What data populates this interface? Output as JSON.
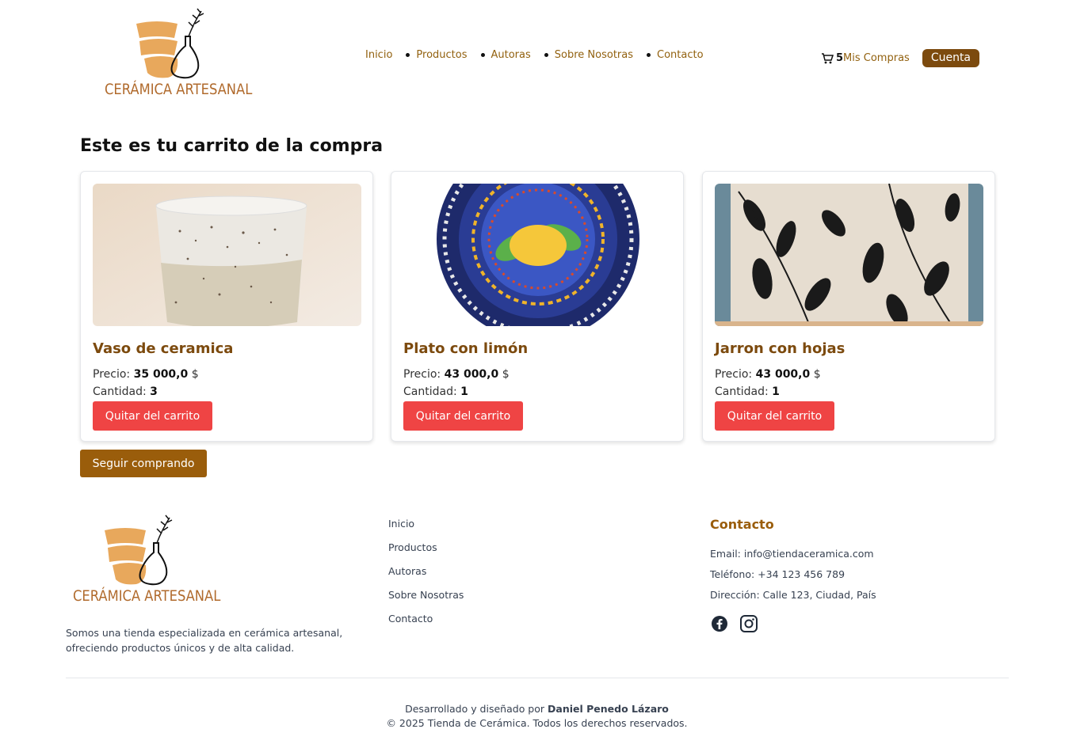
{
  "header": {
    "logo_text": "CERÁMICA ARTESANAL",
    "nav": [
      "Inicio",
      "Productos",
      "Autoras",
      "Sobre Nosotras",
      "Contacto"
    ],
    "cart_count": "5",
    "cart_label": "Mis Compras",
    "account_label": "Cuenta"
  },
  "main": {
    "title": "Este es tu carrito de la compra",
    "price_label": "Precio:",
    "qty_label": "Cantidad:",
    "currency": "$",
    "remove_label": "Quitar del carrito",
    "items": [
      {
        "name": "Vaso de ceramica",
        "price": "35 000,0",
        "qty": "3"
      },
      {
        "name": "Plato con limón",
        "price": "43 000,0",
        "qty": "1"
      },
      {
        "name": "Jarron con hojas",
        "price": "43 000,0",
        "qty": "1"
      }
    ],
    "continue_label": "Seguir comprando"
  },
  "footer": {
    "logo_text": "CERÁMICA ARTESANAL",
    "description": "Somos una tienda especializada en cerámica artesanal, ofreciendo productos únicos y de alta calidad.",
    "links": [
      "Inicio",
      "Productos",
      "Autoras",
      "Sobre Nosotras",
      "Contacto"
    ],
    "contact_title": "Contacto",
    "email": "Email: info@tiendaceramica.com",
    "phone": "Teléfono: +34 123 456 789",
    "address": "Dirección: Calle 123, Ciudad, País",
    "credits_prefix": "Desarrollado y diseñado por",
    "credits_author": "Daniel Penedo Lázaro",
    "copyright": "© 2025 Tienda de Cerámica. Todos los derechos reservados."
  },
  "colors": {
    "brand": "#7c4a0e",
    "accent": "#9a5d0b",
    "danger": "#ef4444",
    "logo_shape": "#e8a85c"
  }
}
